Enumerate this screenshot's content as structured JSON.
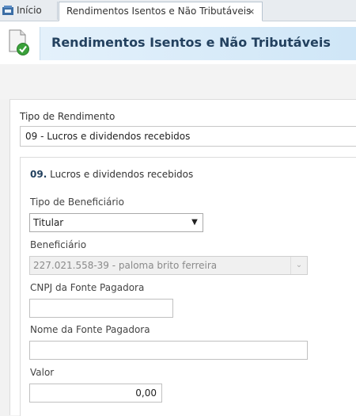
{
  "tabs": {
    "home_label": "Início",
    "active_label": "Rendimentos Isentos e Não Tributáveis",
    "close_glyph": "×"
  },
  "header": {
    "title": "Rendimentos Isentos e Não Tributáveis",
    "icon": "document-check-icon"
  },
  "form": {
    "tipo_rendimento_label": "Tipo de Rendimento",
    "tipo_rendimento_value": "09 - Lucros e dividendos recebidos",
    "section_number": "09.",
    "section_title": "Lucros e dividendos recebidos",
    "tipo_beneficiario_label": "Tipo de Beneficiário",
    "tipo_beneficiario_value": "Titular",
    "beneficiario_label": "Beneficiário",
    "beneficiario_value": "227.021.558-39 - paloma brito ferreira",
    "cnpj_label": "CNPJ da Fonte Pagadora",
    "cnpj_value": "",
    "nome_fonte_label": "Nome da Fonte Pagadora",
    "nome_fonte_value": "",
    "valor_label": "Valor",
    "valor_value": "0,00"
  },
  "colors": {
    "title_text": "#23415f",
    "header_band": "#d6e9f8",
    "check_green": "#3aa13a"
  }
}
